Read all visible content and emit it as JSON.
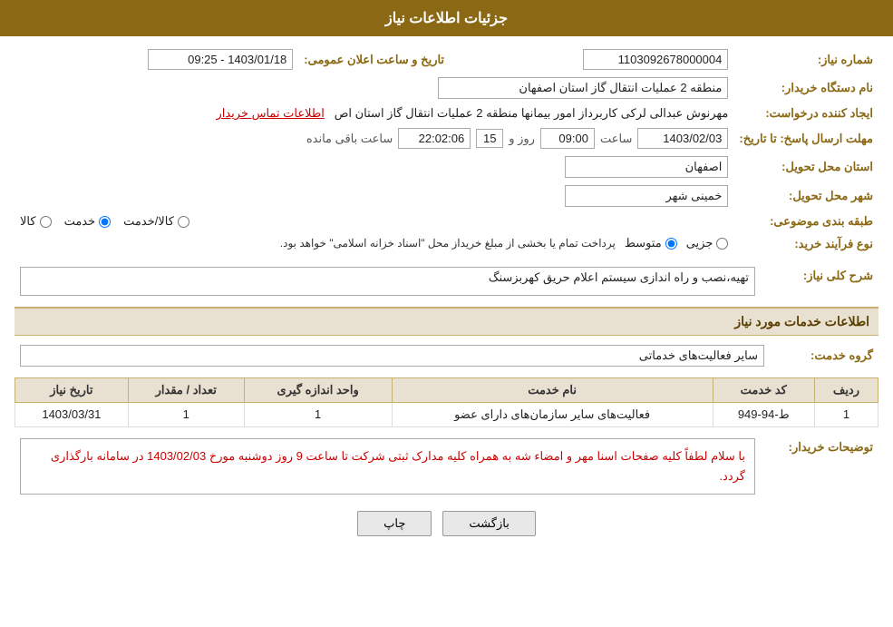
{
  "header": {
    "title": "جزئیات اطلاعات نیاز"
  },
  "fields": {
    "order_number_label": "شماره نیاز:",
    "order_number_value": "1103092678000004",
    "announce_label": "تاریخ و ساعت اعلان عمومی:",
    "announce_value": "1403/01/18 - 09:25",
    "buyer_label": "نام دستگاه خریدار:",
    "buyer_value": "منطقه 2 عملیات انتقال گاز استان اصفهان",
    "creator_label": "ایجاد کننده درخواست:",
    "creator_name": "مهرنوش عبدالی لرکی کاربرداز امور بیمانها منطقه 2 عملیات انتقال گاز استان اص",
    "contact_link": "اطلاعات تماس خریدار",
    "reply_label": "مهلت ارسال پاسخ: تا تاریخ:",
    "reply_date": "1403/02/03",
    "reply_time_label": "ساعت",
    "reply_time_value": "09:00",
    "reply_day_label": "روز و",
    "reply_day_value": "15",
    "reply_remain_label": "ساعت باقی مانده",
    "reply_remain_value": "22:02:06",
    "province_label": "استان محل تحویل:",
    "province_value": "اصفهان",
    "city_label": "شهر محل تحویل:",
    "city_value": "خمینی شهر",
    "category_label": "طبقه بندی موضوعی:",
    "category_options": [
      "کالا",
      "خدمت",
      "کالا/خدمت"
    ],
    "category_selected": "خدمت",
    "process_label": "نوع فرآیند خرید:",
    "process_options": [
      "جزیی",
      "متوسط"
    ],
    "process_note": "پرداخت تمام یا بخشی از مبلغ خریداز محل \"اسناد خزانه اسلامی\" خواهد بود.",
    "description_label": "شرح کلی نیاز:",
    "description_value": "تهیه،نصب و راه اندازی سیستم اعلام حریق کهربزسنگ",
    "services_section": "اطلاعات خدمات مورد نیاز",
    "service_group_label": "گروه خدمت:",
    "service_group_value": "سایر فعالیت‌های خدماتی",
    "table": {
      "headers": [
        "ردیف",
        "کد خدمت",
        "نام خدمت",
        "واحد اندازه گیری",
        "تعداد / مقدار",
        "تاریخ نیاز"
      ],
      "rows": [
        {
          "row": "1",
          "code": "ط-94-949",
          "name": "فعالیت‌های سایر سازمان‌های دارای عضو",
          "unit": "1",
          "qty": "1",
          "date": "1403/03/31"
        }
      ]
    },
    "buyer_notes_label": "توضیحات خریدار:",
    "buyer_notes": "با سلام لطفاً کلیه صفحات اسنا مهر و امضاء شه به همراه کلیه مدارک ثبتی شرکت تا ساعت 9 روز دوشنبه مورخ 1403/02/03 در سامانه بارگذاری گردد.",
    "btn_back": "بازگشت",
    "btn_print": "چاپ"
  }
}
